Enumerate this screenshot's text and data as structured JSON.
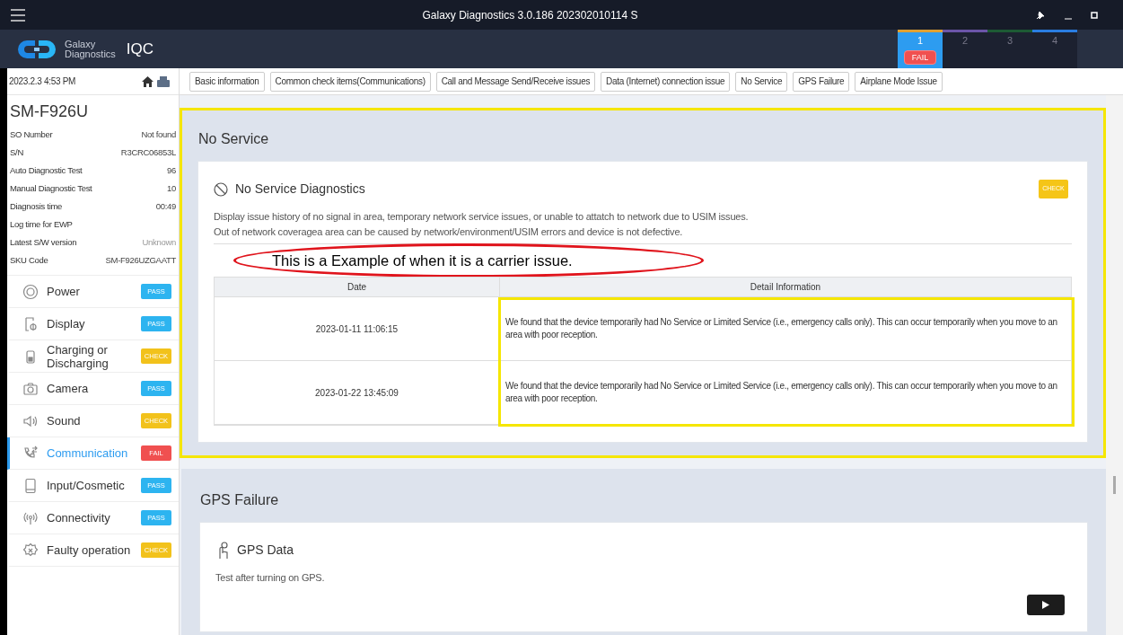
{
  "window": {
    "title": "Galaxy Diagnostics 3.0.186 202302010114 S"
  },
  "header": {
    "brand_line1": "Galaxy",
    "brand_line2": "Diagnostics",
    "product": "IQC",
    "slots": [
      {
        "label": "1",
        "selected": true,
        "color": "#e0a030",
        "badge": "FAIL"
      },
      {
        "label": "2",
        "selected": false,
        "color": "#6b55a8"
      },
      {
        "label": "3",
        "selected": false,
        "color": "#1d5a34"
      },
      {
        "label": "4",
        "selected": false,
        "color": "#2a7de1"
      }
    ]
  },
  "sidebar": {
    "datetime": "2023.2.3 4:53 PM",
    "model": "SM-F926U",
    "info": [
      {
        "label": "SO Number",
        "value": "Not found",
        "dimmed": false
      },
      {
        "label": "S/N",
        "value": "R3CRC06853L",
        "dimmed": false
      },
      {
        "label": "Auto Diagnostic Test",
        "value": "96",
        "dimmed": false
      },
      {
        "label": "Manual Diagnostic Test",
        "value": "10",
        "dimmed": false
      },
      {
        "label": "Diagnosis time",
        "value": "00:49",
        "dimmed": false
      },
      {
        "label": "Log time for EWP"
      },
      {
        "label": "Latest S/W version",
        "value": "Unknown",
        "dimmed": true
      },
      {
        "label": "SKU Code",
        "value": "SM-F926UZGAATT",
        "dimmed": false
      }
    ],
    "categories": [
      {
        "label": "Power",
        "badge": "PASS",
        "kind": "pass",
        "selected": false
      },
      {
        "label": "Display",
        "badge": "PASS",
        "kind": "pass",
        "selected": false
      },
      {
        "label": "Charging or Discharging",
        "badge": "CHECK",
        "kind": "check",
        "selected": false
      },
      {
        "label": "Camera",
        "badge": "PASS",
        "kind": "pass",
        "selected": false
      },
      {
        "label": "Sound",
        "badge": "CHECK",
        "kind": "check",
        "selected": false
      },
      {
        "label": "Communication",
        "badge": "FAIL",
        "kind": "fail",
        "selected": true
      },
      {
        "label": "Input/Cosmetic",
        "badge": "PASS",
        "kind": "pass",
        "selected": false
      },
      {
        "label": "Connectivity",
        "badge": "PASS",
        "kind": "pass",
        "selected": false
      },
      {
        "label": "Faulty operation",
        "badge": "CHECK",
        "kind": "check",
        "selected": false
      }
    ]
  },
  "filter_tabs": [
    "Basic information",
    "Common check items(Communications)",
    "Call and Message Send/Receive issues",
    "Data (Internet) connection issue",
    "No Service",
    "GPS Failure",
    "Airplane Mode Issue"
  ],
  "sections": [
    {
      "title": "No Service",
      "highlighted": true,
      "card": {
        "title": "No Service Diagnostics",
        "button": "CHECK",
        "description": [
          "Display issue history of no signal in area, temporary network service issues, or unable to attatch to network due to USIM issues.",
          "Out of network coveragea area can be caused by network/environment/USIM errors and device is not defective."
        ],
        "note": "This is a Example of when it is a carrier issue.",
        "table": {
          "columns": [
            "Date",
            "Detail Information"
          ],
          "highlight_column": true,
          "rows": [
            [
              "2023-01-11 11:06:15",
              "We found that the device temporarily had No Service or Limited Service (i.e., emergency calls only). This can occur temporarily when you move to an area with poor reception."
            ],
            [
              "2023-01-22 13:45:09",
              "We found that the device temporarily had No Service or Limited Service (i.e., emergency calls only). This can occur temporarily when you move to an area with poor reception."
            ]
          ]
        }
      }
    },
    {
      "title": "GPS Failure",
      "highlighted": false,
      "card": {
        "title": "GPS Data",
        "description": [
          "Test after turning on GPS."
        ]
      }
    }
  ]
}
